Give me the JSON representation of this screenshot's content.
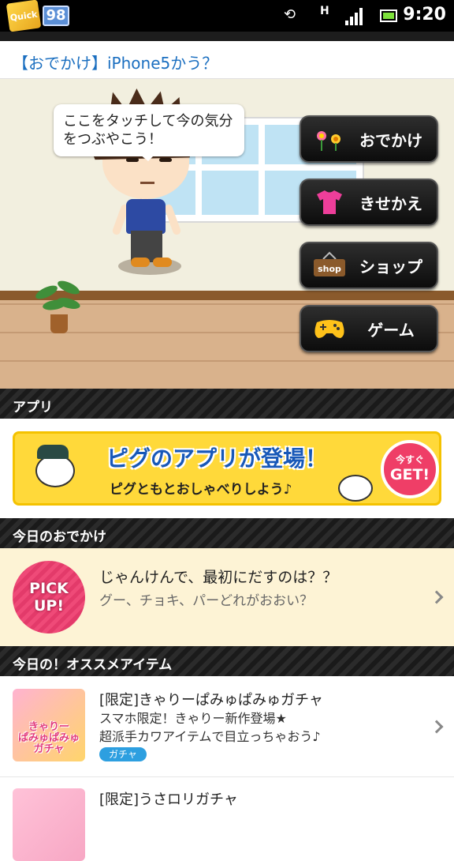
{
  "status_bar": {
    "app_icon_text": "Quick",
    "notification_count": "98",
    "network": "H",
    "time": "9:20"
  },
  "topic": {
    "text": "【おでかけ】iPhone5かう？"
  },
  "room": {
    "bubble_text": "ここをタッチして今の気分をつぶやこう！",
    "menu": [
      {
        "label": "おでかけ",
        "icon": "flowers-icon"
      },
      {
        "label": "きせかえ",
        "icon": "tshirt-icon"
      },
      {
        "label": "ショップ",
        "icon": "shop-sign-icon",
        "icon_text": "shop"
      },
      {
        "label": "ゲーム",
        "icon": "gamepad-icon"
      }
    ]
  },
  "sections": {
    "app": "アプリ",
    "today_outing": "今日のおでかけ",
    "today_items": "今日の！オススメアイテム"
  },
  "banner": {
    "title": "ピグのアプリが登場！",
    "subtitle": "ピグともとおしゃべりしよう♪",
    "cta_top": "今すぐ",
    "cta_bottom": "GET!"
  },
  "outing": {
    "badge_line1": "PICK",
    "badge_line2": "UP!",
    "question": "じゃんけんで、最初にだすのは？？",
    "choices": "グー、チョキ、パーどれがおおい？"
  },
  "items": [
    {
      "name": "[限定]きゃりーぱみゅぱみゅガチャ",
      "desc_line1": "スマホ限定！きゃりー新作登場★",
      "desc_line2": "超派手カワアイテムで目立っちゃおう♪",
      "tag": "ガチャ",
      "thumb_text_line1": "きゃりー",
      "thumb_text_line2": "ぱみゅぱみゅ",
      "thumb_text_line3": "ガチャ"
    },
    {
      "name": "[限定]うさロリガチャ"
    }
  ],
  "colors": {
    "link_blue": "#1b6fc0",
    "banner_yellow": "#ffd93a",
    "pick_pink": "#ef4a78",
    "tag_blue": "#2d9fe0"
  }
}
